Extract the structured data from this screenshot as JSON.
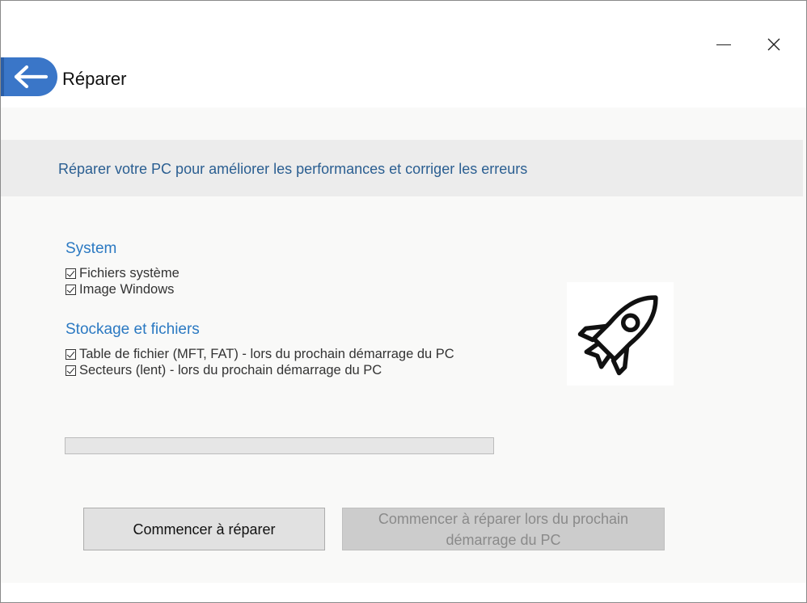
{
  "window": {
    "title": "Réparer",
    "minimize_glyph": "",
    "close_glyph": "✕"
  },
  "banner": {
    "text": "Réparer votre PC pour améliorer les performances et corriger les erreurs"
  },
  "sections": {
    "system": {
      "title": "System",
      "items": [
        {
          "label": "Fichiers système",
          "checked": true
        },
        {
          "label": "Image Windows",
          "checked": true
        }
      ]
    },
    "storage": {
      "title": "Stockage et fichiers",
      "items": [
        {
          "label": "Table de fichier (MFT, FAT)  -  lors du prochain démarrage du PC",
          "checked": true
        },
        {
          "label": "Secteurs (lent)  -  lors du prochain démarrage du PC",
          "checked": true
        }
      ]
    }
  },
  "icons": {
    "back": "arrow-left-icon",
    "hero": "rocket-icon"
  },
  "progress": {
    "value": 0
  },
  "buttons": {
    "start_label": "Commencer à réparer",
    "start_next_boot_label": "Commencer à réparer lors du prochain démarrage du PC"
  },
  "colors": {
    "accent": "#3a76c8",
    "section_title": "#2b79c2",
    "banner_text": "#2a5e91",
    "progress_fill": "#06b025"
  }
}
